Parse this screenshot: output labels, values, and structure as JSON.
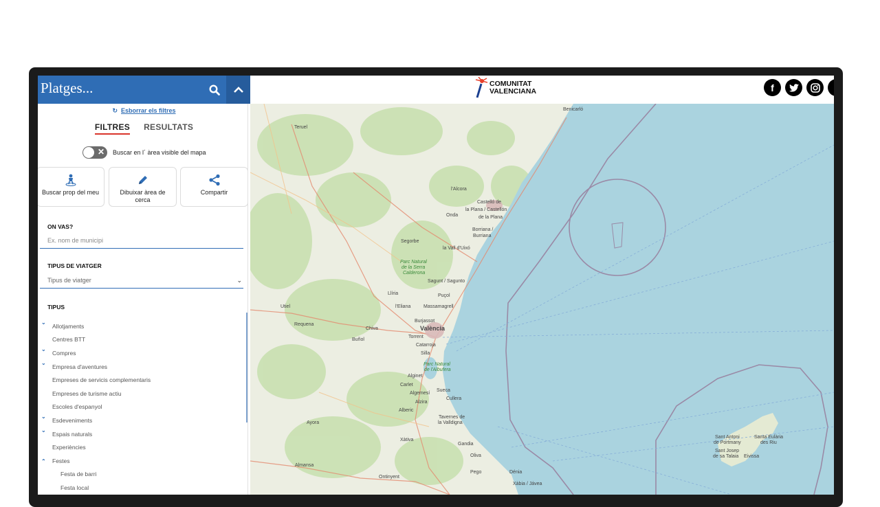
{
  "sidebar": {
    "title": "Platges...",
    "clear_filters": "Esborrar els filtres",
    "tabs": {
      "filters": "FILTRES",
      "results": "RESULTATS"
    },
    "visible_area_toggle": "Buscar en l´ àrea visible del mapa",
    "actions": [
      {
        "label": "Buscar prop del meu",
        "icon": "location-person-icon"
      },
      {
        "label": "Dibuixar àrea de cerca",
        "icon": "pencil-icon"
      },
      {
        "label": "Compartir",
        "icon": "share-icon"
      }
    ],
    "where": {
      "label": "ON VAS?",
      "placeholder": "Ex. nom de municipi"
    },
    "traveller": {
      "label": "TIPUS DE VIATGER",
      "value": "Tipus de viatger"
    },
    "types": {
      "label": "TIPUS",
      "items": [
        {
          "label": "Allotjaments",
          "arrow": "down"
        },
        {
          "label": "Centres BTT",
          "arrow": ""
        },
        {
          "label": "Compres",
          "arrow": "down"
        },
        {
          "label": "Empresa d'aventures",
          "arrow": "down"
        },
        {
          "label": "Empreses de servicis complementaris",
          "arrow": ""
        },
        {
          "label": "Empreses de turisme actiu",
          "arrow": ""
        },
        {
          "label": "Escoles d'espanyol",
          "arrow": ""
        },
        {
          "label": "Esdeveniments",
          "arrow": "down"
        },
        {
          "label": "Espais naturals",
          "arrow": "down"
        },
        {
          "label": "Experiències",
          "arrow": ""
        },
        {
          "label": "Festes",
          "arrow": "up"
        },
        {
          "label": "Festa de barri",
          "arrow": "",
          "child": true
        },
        {
          "label": "Festa local",
          "arrow": "",
          "child": true
        }
      ]
    }
  },
  "header": {
    "logo_line1": "COMUNITAT",
    "logo_line2": "VALENCIANA",
    "socials": [
      "facebook-icon",
      "twitter-icon",
      "instagram-icon",
      "youtube-icon"
    ]
  },
  "map": {
    "places": {
      "teruel": "Teruel",
      "benicarlo": "Benicarló",
      "lalcora": "l'Alcora",
      "castellon1": "Castelló de",
      "castellon2": "la Plana / Castellón",
      "castellon3": "de la Plana",
      "onda": "Onda",
      "borriana1": "Borriana /",
      "borriana2": "Burriana",
      "segorbe": "Segorbe",
      "vallduixo": "la Vall d'Uixó",
      "serra1": "Parc Natural",
      "serra2": "de la Serra",
      "serra3": "Calderona",
      "sagunt": "Sagunt / Sagunto",
      "lliria": "Llíria",
      "pucol": "Puçol",
      "leliana": "l'Eliana",
      "massamagrell": "Massamagrell",
      "utiel": "Utiel",
      "requena": "Requena",
      "chiva": "Chiva",
      "burjassot": "Burjassot",
      "valencia": "València",
      "bunol": "Buñol",
      "torrent": "Torrent",
      "catarroja": "Catarroja",
      "silla": "Silla",
      "albufera1": "Parc Natural",
      "albufera2": "de l'Albufera",
      "alginet": "Alginet",
      "carlet": "Carlet",
      "algemesi": "Algemesí",
      "sueca": "Sueca",
      "alzira": "Alzira",
      "cullera": "Cullera",
      "alberic": "Alberic",
      "tavernes1": "Tavernes de",
      "tavernes2": "la Valldigna",
      "ayora": "Ayora",
      "xativa": "Xàtiva",
      "gandia": "Gandia",
      "oliva": "Oliva",
      "almansa": "Almansa",
      "ontinyent": "Ontinyent",
      "pego": "Pego",
      "denia": "Dénia",
      "xabia": "Xàbia / Jávea",
      "santantoni1": "Sant Antoni",
      "santantoni2": "de Portmany",
      "santaeulalia1": "Santa Eulària",
      "santaeulalia2": "des Riu",
      "santjosep1": "Sant Josep",
      "santjosep2": "de sa Talaia",
      "eivissa": "Eivissa"
    }
  }
}
